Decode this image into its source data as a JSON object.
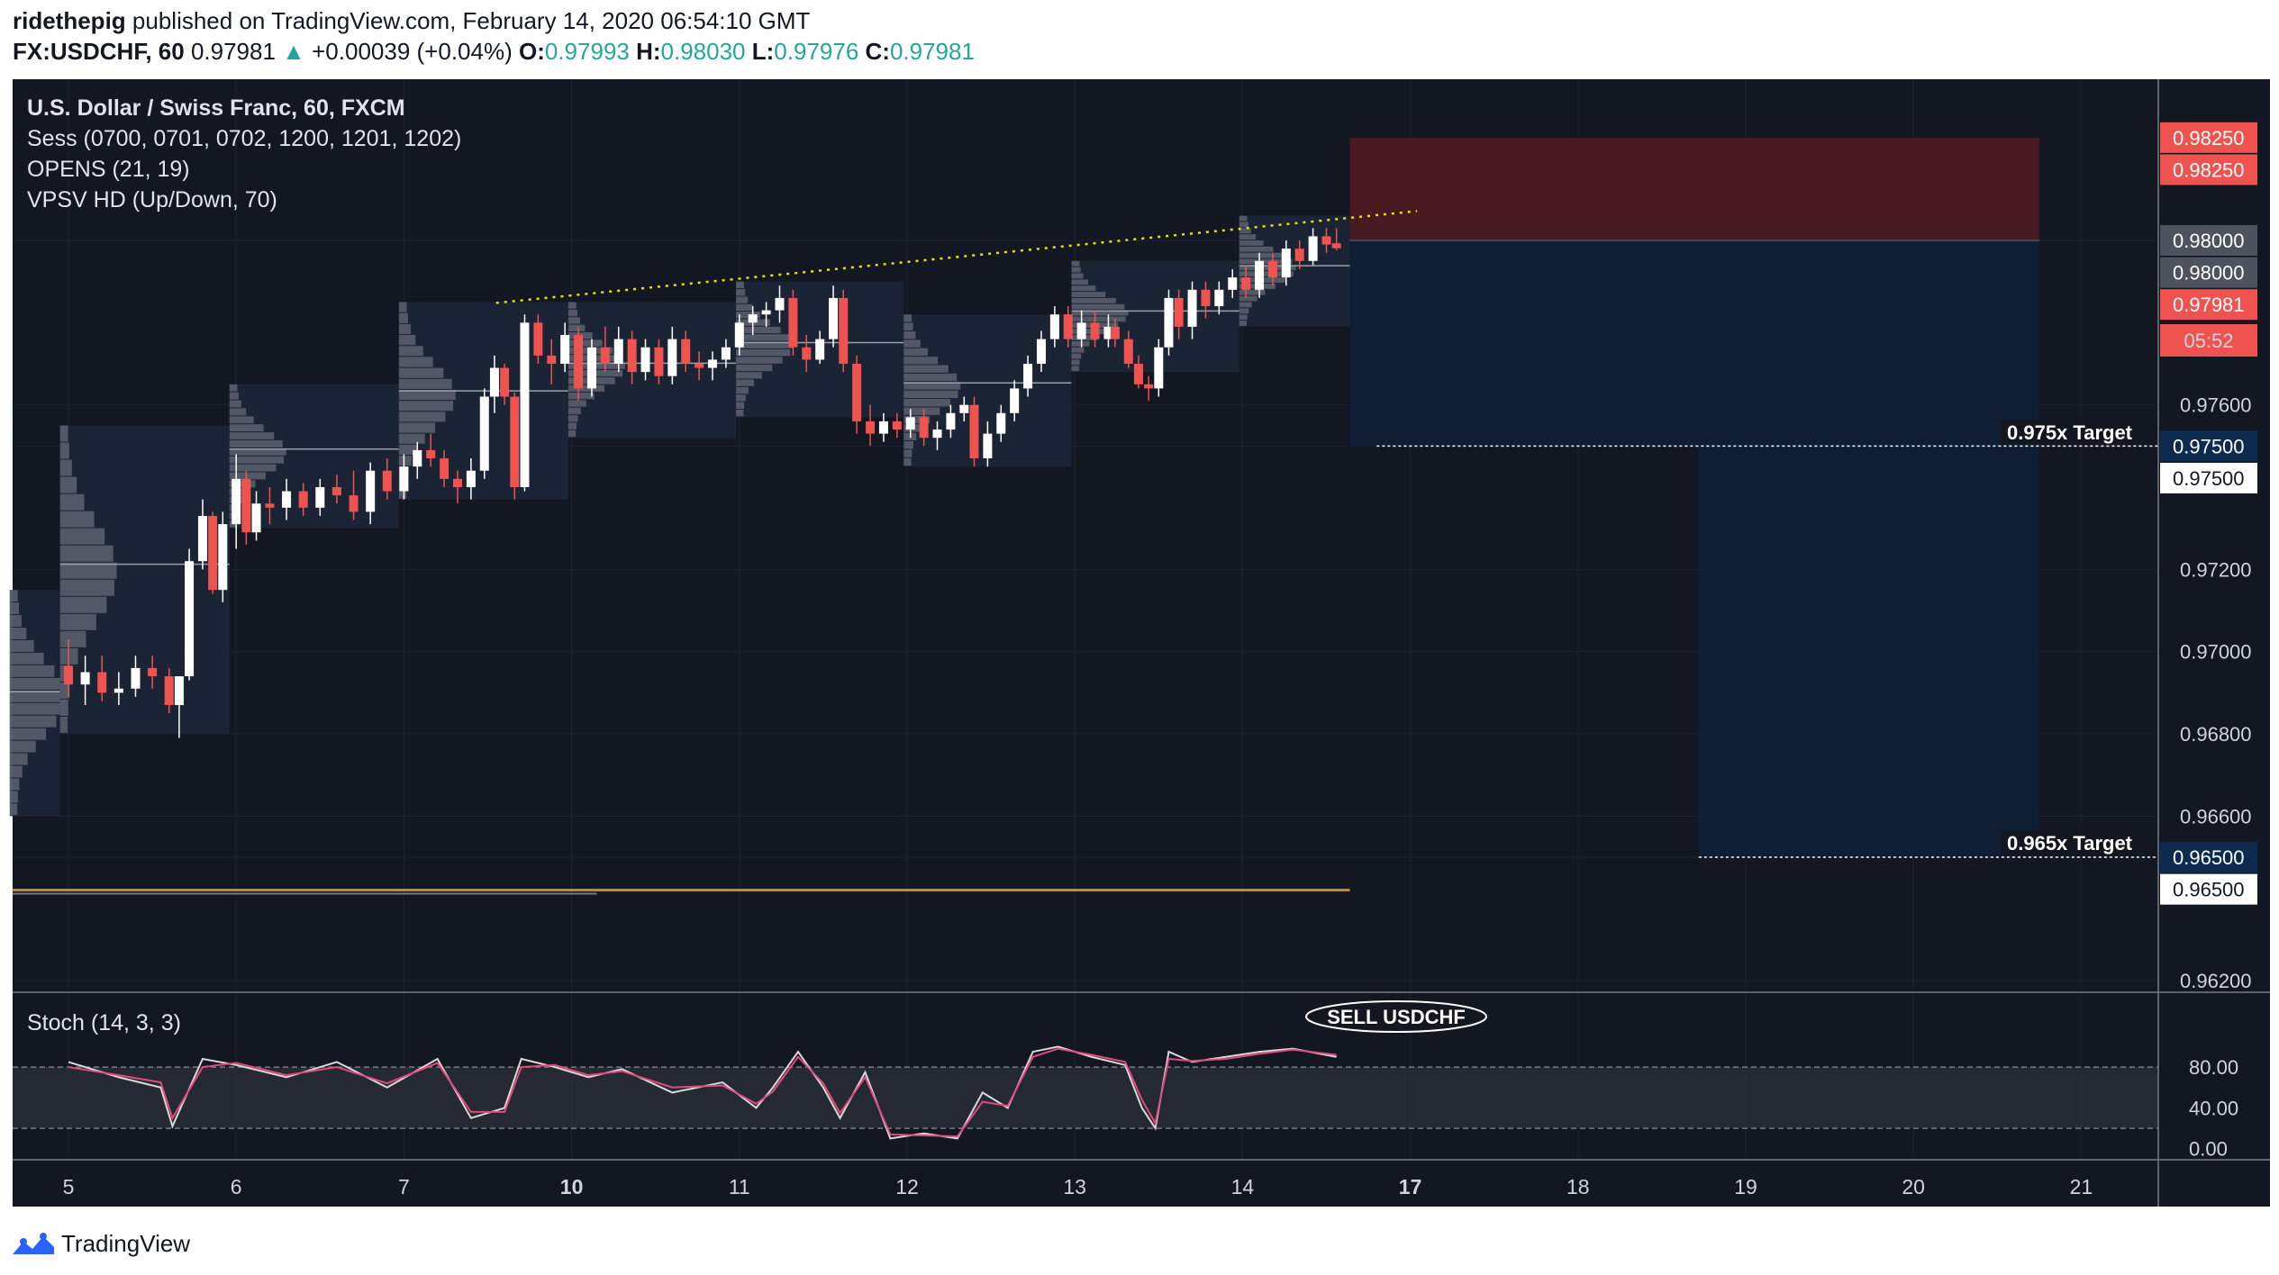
{
  "header": {
    "author": "ridethepig",
    "published": "published on TradingView.com, February 14, 2020 06:54:10 GMT",
    "symbol": "FX:USDCHF, 60",
    "last": "0.97981",
    "change": "+0.00039 (+0.04%)",
    "o_label": "O:",
    "o": "0.97993",
    "h_label": "H:",
    "h": "0.98030",
    "l_label": "L:",
    "l": "0.97976",
    "c_label": "C:",
    "c": "0.97981"
  },
  "legend": {
    "line1": "U.S. Dollar / Swiss Franc, 60, FXCM",
    "line2": "Sess (0700, 0701, 0702, 1200, 1201, 1202)",
    "line3": "OPENS (21, 19)",
    "line4": "VPSV HD (Up/Down, 70)",
    "stoch": "Stoch (14, 3, 3)"
  },
  "annotations": {
    "target1": "0.975x Target",
    "target2": "0.965x Target",
    "sell": "SELL USDCHF",
    "countdown": "05:52"
  },
  "footer": {
    "brand": "TradingView"
  },
  "colors": {
    "background": "#131722",
    "up": "#ffffff",
    "down": "#ef5350",
    "stop_zone": "#4a1a22",
    "target_zone": "#0f1e33",
    "trendline": "#e6e600",
    "orange_line": "#c88a1e",
    "stoch_k": "#d9d9d9",
    "stoch_d": "#e04a7e"
  },
  "chart_data": [
    {
      "type": "candlestick",
      "title": "U.S. Dollar / Swiss Franc, 60, FXCM",
      "xlabel": "",
      "ylabel": "",
      "x_ticks": [
        "5",
        "6",
        "7",
        "10",
        "11",
        "12",
        "13",
        "14",
        "17",
        "18",
        "19",
        "20",
        "21"
      ],
      "y_ticks": [
        "0.98000",
        "0.97600",
        "0.97500",
        "0.97200",
        "0.97000",
        "0.96800",
        "0.96600",
        "0.96500",
        "0.96200"
      ],
      "ylim": [
        0.9608,
        0.9853
      ],
      "price_badges": [
        {
          "label": "0.98250",
          "value": 0.9825,
          "style": "red"
        },
        {
          "label": "0.98250",
          "value": 0.98172,
          "style": "red"
        },
        {
          "label": "0.98000",
          "value": 0.98,
          "style": "gray"
        },
        {
          "label": "0.98000",
          "value": 0.97922,
          "style": "gray"
        },
        {
          "label": "0.97981",
          "value": 0.97844,
          "style": "red"
        },
        {
          "label": "0.97500",
          "value": 0.975,
          "style": "navy"
        },
        {
          "label": "0.97500",
          "value": 0.97422,
          "style": "white"
        },
        {
          "label": "0.96500",
          "value": 0.965,
          "style": "navy"
        },
        {
          "label": "0.96500",
          "value": 0.96422,
          "style": "white"
        }
      ],
      "levels": {
        "entry": 0.98,
        "stop": 0.9825,
        "target1": 0.975,
        "target2": 0.965,
        "orange_line": 0.9642
      },
      "trendline": {
        "from_day": 2.55,
        "from_price": 0.97848,
        "to_day": 7.64,
        "to_price": 0.98055
      },
      "ohlc": [
        {
          "day": 0.0,
          "o": 0.96965,
          "h": 0.9703,
          "l": 0.9689,
          "c": 0.9692
        },
        {
          "day": 0.1,
          "o": 0.9692,
          "h": 0.9699,
          "l": 0.9687,
          "c": 0.9695
        },
        {
          "day": 0.2,
          "o": 0.9695,
          "h": 0.9699,
          "l": 0.9688,
          "c": 0.969
        },
        {
          "day": 0.3,
          "o": 0.969,
          "h": 0.9695,
          "l": 0.9687,
          "c": 0.9691
        },
        {
          "day": 0.4,
          "o": 0.9691,
          "h": 0.9699,
          "l": 0.9689,
          "c": 0.9696
        },
        {
          "day": 0.5,
          "o": 0.9696,
          "h": 0.9699,
          "l": 0.9691,
          "c": 0.9694
        },
        {
          "day": 0.6,
          "o": 0.9694,
          "h": 0.9696,
          "l": 0.9685,
          "c": 0.9687
        },
        {
          "day": 0.66,
          "o": 0.9687,
          "h": 0.969,
          "l": 0.9679,
          "c": 0.9694
        },
        {
          "day": 0.72,
          "o": 0.9694,
          "h": 0.9725,
          "l": 0.9693,
          "c": 0.9722
        },
        {
          "day": 0.8,
          "o": 0.9722,
          "h": 0.9737,
          "l": 0.972,
          "c": 0.9733
        },
        {
          "day": 0.86,
          "o": 0.9733,
          "h": 0.9734,
          "l": 0.9714,
          "c": 0.9715
        },
        {
          "day": 0.92,
          "o": 0.9715,
          "h": 0.9734,
          "l": 0.9712,
          "c": 0.9731
        },
        {
          "day": 1.0,
          "o": 0.9731,
          "h": 0.9748,
          "l": 0.9725,
          "c": 0.9742
        },
        {
          "day": 1.06,
          "o": 0.9742,
          "h": 0.9744,
          "l": 0.9726,
          "c": 0.9729
        },
        {
          "day": 1.12,
          "o": 0.9729,
          "h": 0.9739,
          "l": 0.9727,
          "c": 0.9736
        },
        {
          "day": 1.2,
          "o": 0.9736,
          "h": 0.974,
          "l": 0.9731,
          "c": 0.9735
        },
        {
          "day": 1.3,
          "o": 0.9735,
          "h": 0.9742,
          "l": 0.9732,
          "c": 0.9739
        },
        {
          "day": 1.4,
          "o": 0.9739,
          "h": 0.9741,
          "l": 0.9733,
          "c": 0.9735
        },
        {
          "day": 1.5,
          "o": 0.9735,
          "h": 0.9742,
          "l": 0.9733,
          "c": 0.974
        },
        {
          "day": 1.6,
          "o": 0.974,
          "h": 0.9743,
          "l": 0.9736,
          "c": 0.9738
        },
        {
          "day": 1.7,
          "o": 0.9738,
          "h": 0.9744,
          "l": 0.9732,
          "c": 0.9734
        },
        {
          "day": 1.8,
          "o": 0.9734,
          "h": 0.9746,
          "l": 0.9731,
          "c": 0.9744
        },
        {
          "day": 1.9,
          "o": 0.9744,
          "h": 0.9747,
          "l": 0.9737,
          "c": 0.9739
        },
        {
          "day": 2.0,
          "o": 0.9739,
          "h": 0.9748,
          "l": 0.9737,
          "c": 0.9745
        },
        {
          "day": 2.08,
          "o": 0.9745,
          "h": 0.9751,
          "l": 0.9742,
          "c": 0.9749
        },
        {
          "day": 2.16,
          "o": 0.9749,
          "h": 0.9753,
          "l": 0.9745,
          "c": 0.9747
        },
        {
          "day": 2.24,
          "o": 0.9747,
          "h": 0.9749,
          "l": 0.974,
          "c": 0.9742
        },
        {
          "day": 2.32,
          "o": 0.9742,
          "h": 0.9744,
          "l": 0.9736,
          "c": 0.974
        },
        {
          "day": 2.4,
          "o": 0.974,
          "h": 0.9747,
          "l": 0.9737,
          "c": 0.9744
        },
        {
          "day": 2.48,
          "o": 0.9744,
          "h": 0.9764,
          "l": 0.9742,
          "c": 0.9762
        },
        {
          "day": 2.54,
          "o": 0.9762,
          "h": 0.9772,
          "l": 0.9758,
          "c": 0.9769
        },
        {
          "day": 2.6,
          "o": 0.9769,
          "h": 0.977,
          "l": 0.976,
          "c": 0.9762
        },
        {
          "day": 2.66,
          "o": 0.9762,
          "h": 0.9763,
          "l": 0.9737,
          "c": 0.974
        },
        {
          "day": 2.72,
          "o": 0.974,
          "h": 0.9782,
          "l": 0.9739,
          "c": 0.978
        },
        {
          "day": 2.8,
          "o": 0.978,
          "h": 0.9782,
          "l": 0.977,
          "c": 0.9772
        },
        {
          "day": 2.88,
          "o": 0.9772,
          "h": 0.9776,
          "l": 0.9765,
          "c": 0.977
        },
        {
          "day": 2.96,
          "o": 0.977,
          "h": 0.978,
          "l": 0.9768,
          "c": 0.9777
        },
        {
          "day": 3.04,
          "o": 0.9777,
          "h": 0.9779,
          "l": 0.9761,
          "c": 0.9764
        },
        {
          "day": 3.12,
          "o": 0.9764,
          "h": 0.9776,
          "l": 0.9762,
          "c": 0.9774
        },
        {
          "day": 3.2,
          "o": 0.9774,
          "h": 0.9779,
          "l": 0.9768,
          "c": 0.977
        },
        {
          "day": 3.28,
          "o": 0.977,
          "h": 0.9779,
          "l": 0.9768,
          "c": 0.9776
        },
        {
          "day": 3.36,
          "o": 0.9776,
          "h": 0.9778,
          "l": 0.9765,
          "c": 0.9768
        },
        {
          "day": 3.44,
          "o": 0.9768,
          "h": 0.9776,
          "l": 0.9766,
          "c": 0.9774
        },
        {
          "day": 3.52,
          "o": 0.9774,
          "h": 0.9776,
          "l": 0.9765,
          "c": 0.9767
        },
        {
          "day": 3.6,
          "o": 0.9767,
          "h": 0.9779,
          "l": 0.9765,
          "c": 0.9776
        },
        {
          "day": 3.68,
          "o": 0.9776,
          "h": 0.9778,
          "l": 0.9768,
          "c": 0.977
        },
        {
          "day": 3.76,
          "o": 0.977,
          "h": 0.9773,
          "l": 0.9766,
          "c": 0.9769
        },
        {
          "day": 3.84,
          "o": 0.9769,
          "h": 0.9773,
          "l": 0.9766,
          "c": 0.9771
        },
        {
          "day": 3.92,
          "o": 0.9771,
          "h": 0.9776,
          "l": 0.9769,
          "c": 0.9774
        },
        {
          "day": 4.0,
          "o": 0.9774,
          "h": 0.9782,
          "l": 0.9772,
          "c": 0.978
        },
        {
          "day": 4.08,
          "o": 0.978,
          "h": 0.9784,
          "l": 0.9777,
          "c": 0.9782
        },
        {
          "day": 4.16,
          "o": 0.9782,
          "h": 0.9785,
          "l": 0.9779,
          "c": 0.9783
        },
        {
          "day": 4.24,
          "o": 0.9783,
          "h": 0.9789,
          "l": 0.978,
          "c": 0.9786
        },
        {
          "day": 4.32,
          "o": 0.9786,
          "h": 0.9788,
          "l": 0.9772,
          "c": 0.9774
        },
        {
          "day": 4.4,
          "o": 0.9774,
          "h": 0.9777,
          "l": 0.9768,
          "c": 0.9771
        },
        {
          "day": 4.48,
          "o": 0.9771,
          "h": 0.9778,
          "l": 0.977,
          "c": 0.9776
        },
        {
          "day": 4.56,
          "o": 0.9776,
          "h": 0.9789,
          "l": 0.9774,
          "c": 0.9786
        },
        {
          "day": 4.62,
          "o": 0.9786,
          "h": 0.9788,
          "l": 0.9768,
          "c": 0.977
        },
        {
          "day": 4.7,
          "o": 0.977,
          "h": 0.9772,
          "l": 0.9753,
          "c": 0.9756
        },
        {
          "day": 4.78,
          "o": 0.9756,
          "h": 0.976,
          "l": 0.975,
          "c": 0.9753
        },
        {
          "day": 4.86,
          "o": 0.9753,
          "h": 0.9758,
          "l": 0.9751,
          "c": 0.9756
        },
        {
          "day": 4.94,
          "o": 0.9756,
          "h": 0.9758,
          "l": 0.9752,
          "c": 0.9754
        },
        {
          "day": 5.02,
          "o": 0.9754,
          "h": 0.9759,
          "l": 0.9752,
          "c": 0.9757
        },
        {
          "day": 5.1,
          "o": 0.9757,
          "h": 0.9759,
          "l": 0.975,
          "c": 0.9752
        },
        {
          "day": 5.18,
          "o": 0.9752,
          "h": 0.9756,
          "l": 0.9749,
          "c": 0.9754
        },
        {
          "day": 5.26,
          "o": 0.9754,
          "h": 0.976,
          "l": 0.9752,
          "c": 0.9758
        },
        {
          "day": 5.34,
          "o": 0.9758,
          "h": 0.9762,
          "l": 0.9756,
          "c": 0.976
        },
        {
          "day": 5.4,
          "o": 0.976,
          "h": 0.9762,
          "l": 0.9745,
          "c": 0.9747
        },
        {
          "day": 5.48,
          "o": 0.9747,
          "h": 0.9756,
          "l": 0.9745,
          "c": 0.9753
        },
        {
          "day": 5.56,
          "o": 0.9753,
          "h": 0.976,
          "l": 0.9751,
          "c": 0.9758
        },
        {
          "day": 5.64,
          "o": 0.9758,
          "h": 0.9766,
          "l": 0.9756,
          "c": 0.9764
        },
        {
          "day": 5.72,
          "o": 0.9764,
          "h": 0.9772,
          "l": 0.9762,
          "c": 0.977
        },
        {
          "day": 5.8,
          "o": 0.977,
          "h": 0.9778,
          "l": 0.9768,
          "c": 0.9776
        },
        {
          "day": 5.88,
          "o": 0.9776,
          "h": 0.9784,
          "l": 0.9774,
          "c": 0.9782
        },
        {
          "day": 5.96,
          "o": 0.9782,
          "h": 0.9784,
          "l": 0.9774,
          "c": 0.9776
        },
        {
          "day": 6.04,
          "o": 0.9776,
          "h": 0.9783,
          "l": 0.9774,
          "c": 0.978
        },
        {
          "day": 6.12,
          "o": 0.978,
          "h": 0.9783,
          "l": 0.9774,
          "c": 0.9776
        },
        {
          "day": 6.2,
          "o": 0.9776,
          "h": 0.9782,
          "l": 0.9774,
          "c": 0.9779
        },
        {
          "day": 6.24,
          "o": 0.9779,
          "h": 0.9781,
          "l": 0.9774,
          "c": 0.9776
        },
        {
          "day": 6.32,
          "o": 0.9776,
          "h": 0.9778,
          "l": 0.9769,
          "c": 0.977
        },
        {
          "day": 6.38,
          "o": 0.977,
          "h": 0.9772,
          "l": 0.9764,
          "c": 0.9765
        },
        {
          "day": 6.44,
          "o": 0.9765,
          "h": 0.9767,
          "l": 0.9761,
          "c": 0.9764
        },
        {
          "day": 6.5,
          "o": 0.9764,
          "h": 0.9776,
          "l": 0.9762,
          "c": 0.9774
        },
        {
          "day": 6.56,
          "o": 0.9774,
          "h": 0.9788,
          "l": 0.9772,
          "c": 0.9786
        },
        {
          "day": 6.62,
          "o": 0.9786,
          "h": 0.9788,
          "l": 0.9776,
          "c": 0.9779
        },
        {
          "day": 6.7,
          "o": 0.9779,
          "h": 0.979,
          "l": 0.9776,
          "c": 0.9788
        },
        {
          "day": 6.78,
          "o": 0.9788,
          "h": 0.979,
          "l": 0.9781,
          "c": 0.9784
        },
        {
          "day": 6.86,
          "o": 0.9784,
          "h": 0.979,
          "l": 0.9782,
          "c": 0.9788
        },
        {
          "day": 6.94,
          "o": 0.9788,
          "h": 0.9793,
          "l": 0.9786,
          "c": 0.9791
        },
        {
          "day": 7.02,
          "o": 0.9791,
          "h": 0.9794,
          "l": 0.9786,
          "c": 0.9788
        },
        {
          "day": 7.1,
          "o": 0.9788,
          "h": 0.9797,
          "l": 0.9786,
          "c": 0.9795
        },
        {
          "day": 7.18,
          "o": 0.9795,
          "h": 0.9797,
          "l": 0.9789,
          "c": 0.9791
        },
        {
          "day": 7.26,
          "o": 0.9791,
          "h": 0.98,
          "l": 0.9789,
          "c": 0.9798
        },
        {
          "day": 7.34,
          "o": 0.9798,
          "h": 0.98,
          "l": 0.9793,
          "c": 0.9795
        },
        {
          "day": 7.42,
          "o": 0.9795,
          "h": 0.9803,
          "l": 0.9794,
          "c": 0.9801
        },
        {
          "day": 7.5,
          "o": 0.9801,
          "h": 0.9803,
          "l": 0.9797,
          "c": 0.9799
        },
        {
          "day": 7.56,
          "o": 0.97993,
          "h": 0.9803,
          "l": 0.97976,
          "c": 0.97981
        }
      ]
    },
    {
      "type": "line",
      "title": "Stoch (14, 3, 3)",
      "xlabel": "",
      "ylabel": "",
      "y_ticks": [
        "80.00",
        "40.00",
        "0.00"
      ],
      "ylim": [
        -2,
        118
      ],
      "band": [
        20,
        80
      ],
      "x": [
        0.0,
        0.3,
        0.55,
        0.62,
        0.8,
        1.0,
        1.3,
        1.6,
        1.9,
        2.2,
        2.4,
        2.6,
        2.7,
        2.9,
        3.1,
        3.3,
        3.6,
        3.9,
        4.1,
        4.2,
        4.35,
        4.5,
        4.6,
        4.75,
        4.9,
        5.1,
        5.3,
        5.45,
        5.6,
        5.75,
        5.9,
        6.1,
        6.3,
        6.4,
        6.48,
        6.56,
        6.7,
        6.9,
        7.1,
        7.3,
        7.56
      ],
      "series": [
        {
          "name": "%K",
          "values": [
            85,
            70,
            60,
            22,
            88,
            82,
            70,
            85,
            60,
            88,
            30,
            40,
            88,
            80,
            70,
            78,
            55,
            65,
            40,
            60,
            95,
            60,
            30,
            75,
            10,
            15,
            10,
            55,
            40,
            95,
            100,
            90,
            82,
            40,
            20,
            95,
            85,
            90,
            95,
            98,
            90
          ]
        },
        {
          "name": "%D",
          "values": [
            80,
            72,
            65,
            30,
            80,
            84,
            72,
            80,
            64,
            84,
            36,
            36,
            80,
            82,
            72,
            76,
            60,
            62,
            44,
            56,
            90,
            64,
            35,
            70,
            14,
            13,
            12,
            46,
            42,
            90,
            98,
            92,
            85,
            48,
            25,
            88,
            86,
            88,
            93,
            97,
            92
          ]
        }
      ]
    }
  ]
}
